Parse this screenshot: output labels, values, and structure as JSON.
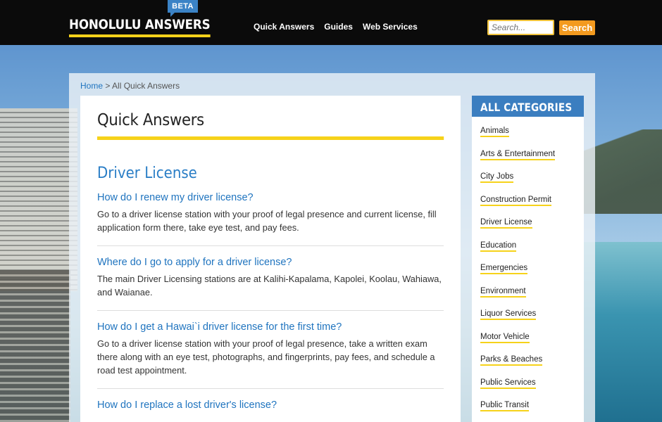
{
  "header": {
    "logo": "HONOLULU ANSWERS",
    "beta": "BETA",
    "nav": [
      "Quick Answers",
      "Guides",
      "Web Services"
    ],
    "search": {
      "placeholder": "Search...",
      "button": "Search"
    },
    "colors": {
      "bar": "#0b0b0b",
      "accent": "#f6d21a",
      "beta": "#3b83c6",
      "button": "#f39a1f"
    }
  },
  "breadcrumb": {
    "home": "Home",
    "separator": ">",
    "current": "All Quick Answers"
  },
  "main": {
    "title": "Quick Answers",
    "section": "Driver License",
    "qas": [
      {
        "q": "How do I renew my driver license?",
        "a": "Go to a driver license station with your proof of legal presence and current license, fill application form there, take eye test, and pay fees."
      },
      {
        "q": "Where do I go to apply for a driver license?",
        "a": "The main Driver Licensing stations are at Kalihi-Kapalama, Kapolei, Koolau, Wahiawa, and Waianae."
      },
      {
        "q": "How do I get a Hawai`i driver license for the first time?",
        "a": "Go to a driver license station with your proof of legal presence, take a written exam there along with an eye test, photographs, and fingerprints, pay fees, and schedule a road test appointment."
      },
      {
        "q": "How do I replace a lost driver's license?",
        "a": ""
      }
    ]
  },
  "sidebar": {
    "title": "ALL CATEGORIES",
    "categories": [
      "Animals",
      "Arts & Entertainment",
      "City Jobs",
      "Construction Permit",
      "Driver License",
      "Education",
      "Emergencies",
      "Environment",
      "Liquor Services",
      "Motor Vehicle",
      "Parks & Beaches",
      "Public Services",
      "Public Transit"
    ]
  }
}
